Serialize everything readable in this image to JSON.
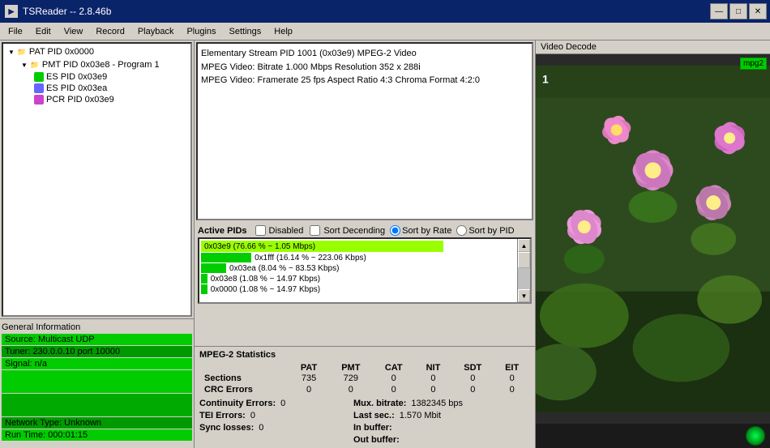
{
  "window": {
    "title": "TSReader -- 2.8.46b",
    "controls": {
      "minimize": "—",
      "maximize": "□",
      "close": "✕"
    }
  },
  "menu": {
    "items": [
      "File",
      "Edit",
      "View",
      "Record",
      "Playback",
      "Plugins",
      "Settings",
      "Help"
    ]
  },
  "tree": {
    "items": [
      {
        "label": "PAT PID 0x0000",
        "level": 1,
        "icon": "folder",
        "expanded": true
      },
      {
        "label": "PMT PID 0x03e8 - Program 1",
        "level": 2,
        "icon": "folder",
        "expanded": true
      },
      {
        "label": "ES PID 0x03e9",
        "level": 3,
        "icon": "es-green"
      },
      {
        "label": "ES PID 0x03ea",
        "level": 3,
        "icon": "es-blue"
      },
      {
        "label": "PCR PID 0x03e9",
        "level": 3,
        "icon": "pcr-purple"
      }
    ]
  },
  "es_info": {
    "lines": [
      "Elementary Stream PID 1001 (0x03e9) MPEG-2 Video",
      "MPEG Video: Bitrate 1.000 Mbps Resolution 352 x 288i",
      "MPEG Video: Framerate 25 fps Aspect Ratio 4:3 Chroma Format 4:2:0"
    ]
  },
  "active_pids": {
    "label": "Active PIDs",
    "options": {
      "disabled": {
        "label": "Disabled",
        "checked": false
      },
      "sort_descending": {
        "label": "Sort Decending",
        "checked": false
      },
      "sort_by_rate": {
        "label": "Sort by Rate",
        "checked": true
      },
      "sort_by_pid": {
        "label": "Sort by PID",
        "checked": false
      }
    },
    "bars": [
      {
        "label": "0x03e9 (76.66 % ~ 1.05 Mbps)",
        "width_pct": 77,
        "color": "green",
        "highlighted": true
      },
      {
        "label": "0x1fff (16.14 % ~ 223.06 Kbps)",
        "width_pct": 16,
        "color": "lime"
      },
      {
        "label": "0x03ea (8.04 % ~ 83.53 Kbps)",
        "width_pct": 8,
        "color": "lime"
      },
      {
        "label": "0x03e8 (1.08 % ~ 14.97 Kbps)",
        "width_pct": 1,
        "color": "lime"
      },
      {
        "label": "0x0000 (1.08 % ~ 14.97 Kbps)",
        "width_pct": 1,
        "color": "lime"
      }
    ]
  },
  "statistics": {
    "title": "MPEG-2 Statistics",
    "headers": [
      "",
      "PAT",
      "PMT",
      "CAT",
      "NIT",
      "SDT",
      "EIT"
    ],
    "sections": {
      "Sections": {
        "values": [
          "735",
          "729",
          "0",
          "0",
          "0",
          "0"
        ]
      },
      "CRC Errors": {
        "values": [
          "0",
          "0",
          "0",
          "0",
          "0",
          "0"
        ]
      },
      "Continuity Errors": {
        "value": "0"
      },
      "TEI Errors": {
        "value": "0"
      },
      "Sync losses": {
        "value": "0"
      },
      "Mux bitrate": {
        "value": "1382345 bps"
      },
      "Last sec": {
        "value": "1.570 Mbit"
      },
      "In buffer": {
        "value": ""
      },
      "Out buffer": {
        "value": ""
      }
    }
  },
  "general_info": {
    "label": "General Information",
    "source": "Source: Multicast UDP",
    "tuner": "Tuner: 230.0.0.10 port 10000",
    "signal": "Signal: n/a",
    "network": "Network Type: Unknown",
    "runtime": "Run Time: 000:01:15"
  },
  "video": {
    "header": "Video Decode",
    "badge": "mpg2",
    "number": "1"
  },
  "colors": {
    "green_bar": "#00cc00",
    "dark_green": "#009900",
    "accent_blue": "#0a246a",
    "highlight_bar": "#66cc00"
  }
}
